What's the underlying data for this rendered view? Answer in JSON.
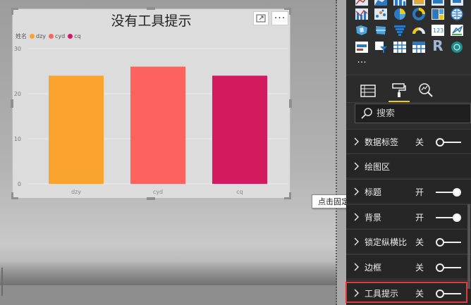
{
  "visual": {
    "title": "没有工具提示",
    "more_label": "···",
    "legend_title": "姓名",
    "legend": [
      {
        "name": "dzy",
        "color": "#FBA32F"
      },
      {
        "name": "cyd",
        "color": "#FD625E"
      },
      {
        "name": "cq",
        "color": "#D41A5F"
      }
    ]
  },
  "chart_data": {
    "type": "bar",
    "categories": [
      "dzy",
      "cyd",
      "cq"
    ],
    "values": [
      24,
      26,
      24
    ],
    "colors": [
      "#FBA32F",
      "#FD625E",
      "#D41A5F"
    ],
    "yticks": [
      0,
      10,
      20,
      30
    ],
    "ylim": [
      0,
      30
    ],
    "legend_title": "姓名",
    "legend_position": "top-left",
    "grid": true
  },
  "tooltip": {
    "text": "点击固定"
  },
  "pane": {
    "search_placeholder": "搜索",
    "cards": [
      {
        "label": "数据标签",
        "state": "关",
        "toggle": "off"
      },
      {
        "label": "绘图区",
        "state": "",
        "toggle": ""
      },
      {
        "label": "标题",
        "state": "开",
        "toggle": "on"
      },
      {
        "label": "背景",
        "state": "开",
        "toggle": "on"
      },
      {
        "label": "锁定纵横比",
        "state": "关",
        "toggle": "off"
      },
      {
        "label": "边框",
        "state": "关",
        "toggle": "off"
      },
      {
        "label": "工具提示",
        "state": "关",
        "toggle": "off"
      }
    ],
    "more_visuals_label": "···",
    "r_visual_label": "R"
  }
}
